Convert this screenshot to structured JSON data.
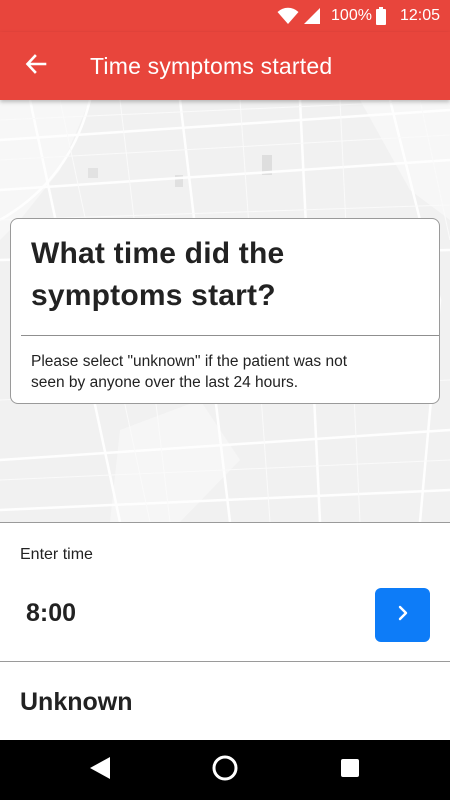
{
  "status_bar": {
    "battery_text": "100%",
    "time": "12:05",
    "icons": [
      "wifi-icon",
      "signal-icon",
      "battery-icon"
    ]
  },
  "app_bar": {
    "title": "Time symptoms started",
    "back_icon": "arrow-left-icon"
  },
  "question_card": {
    "title_line1": "What time did the",
    "title_line2": "symptoms start?",
    "help_line1": "Please select \"unknown\" if the patient was not",
    "help_line2": "seen by anyone over the last 24 hours."
  },
  "time_entry": {
    "label": "Enter time",
    "value": "8:00",
    "submit_icon": "chevron-right-icon"
  },
  "options": {
    "unknown_label": "Unknown"
  },
  "nav_bar": {
    "icons": [
      "back-triangle-icon",
      "home-circle-icon",
      "recents-square-icon"
    ]
  },
  "colors": {
    "primary": "#e8453c",
    "accent": "#0d7cf8",
    "map_background": "#f1f1f1"
  }
}
